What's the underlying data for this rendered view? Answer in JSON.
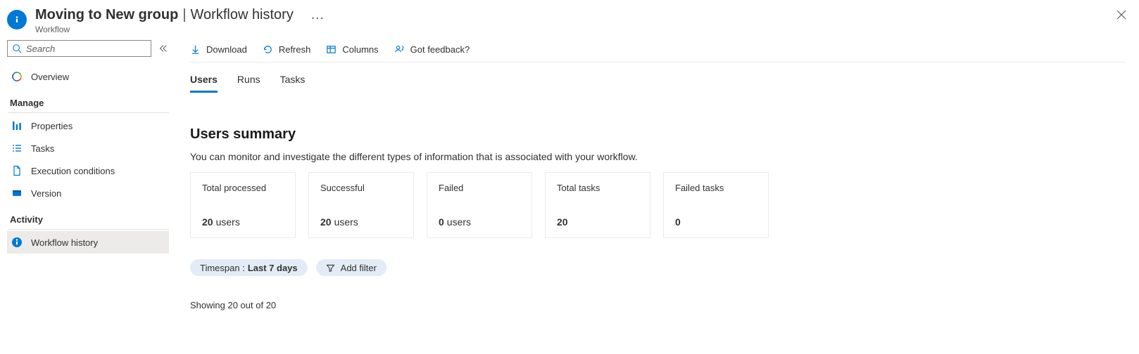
{
  "header": {
    "title_prefix": "Moving to New group",
    "separator": "|",
    "title_page": "Workflow history",
    "overflow": "…",
    "subtitle": "Workflow"
  },
  "search": {
    "placeholder": "Search"
  },
  "sidebar": {
    "overview": "Overview",
    "manage_label": "Manage",
    "properties": "Properties",
    "tasks": "Tasks",
    "execution_conditions": "Execution conditions",
    "version": "Version",
    "activity_label": "Activity",
    "workflow_history": "Workflow history"
  },
  "toolbar": {
    "download": "Download",
    "refresh": "Refresh",
    "columns": "Columns",
    "feedback": "Got feedback?"
  },
  "tabs": {
    "users": "Users",
    "runs": "Runs",
    "tasks": "Tasks"
  },
  "summary": {
    "title": "Users summary",
    "description": "You can monitor and investigate the different types of information that is associated with your workflow.",
    "cards": [
      {
        "label": "Total processed",
        "value": "20",
        "unit": "users"
      },
      {
        "label": "Successful",
        "value": "20",
        "unit": "users"
      },
      {
        "label": "Failed",
        "value": "0",
        "unit": "users"
      },
      {
        "label": "Total tasks",
        "value": "20",
        "unit": ""
      },
      {
        "label": "Failed tasks",
        "value": "0",
        "unit": ""
      }
    ]
  },
  "filters": {
    "timespan_prefix": "Timespan :",
    "timespan_value": "Last 7 days",
    "add_filter": "Add filter"
  },
  "table": {
    "showing": "Showing 20 out of 20"
  }
}
